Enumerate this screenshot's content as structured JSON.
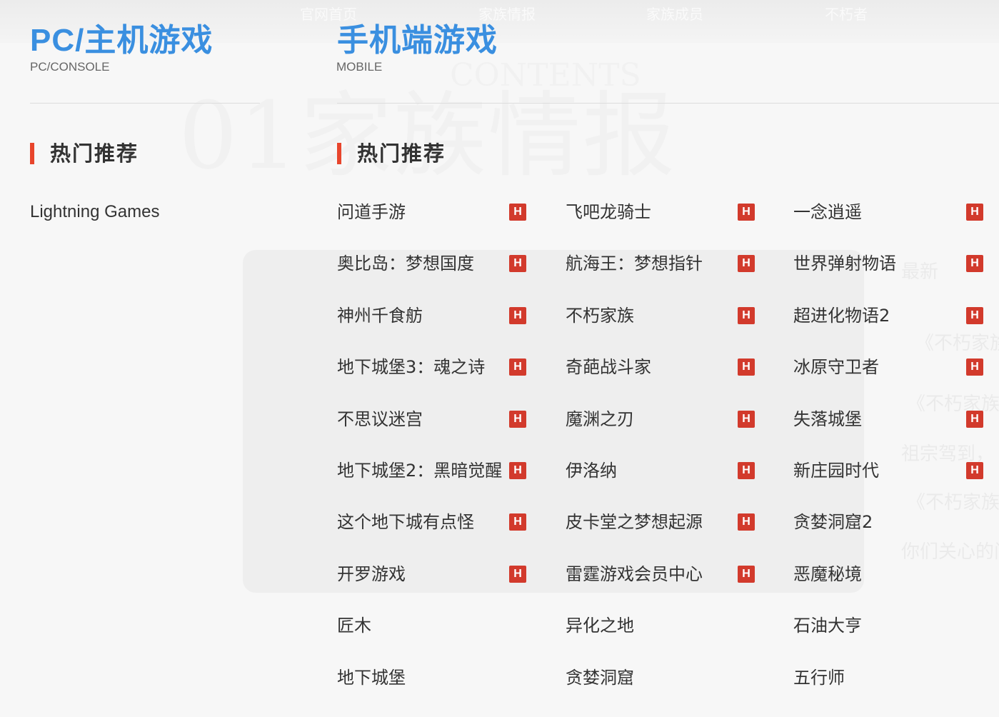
{
  "pc": {
    "title": "PC/主机游戏",
    "subtitle": "PC/CONSOLE",
    "section": "热门推荐",
    "games": [
      {
        "name": "Lightning Games",
        "hot": false
      }
    ]
  },
  "mobile": {
    "title": "手机端游戏",
    "subtitle": "MOBILE",
    "section": "热门推荐",
    "hot_label": "H",
    "columns": [
      [
        {
          "name": "问道手游",
          "hot": true
        },
        {
          "name": "奥比岛：梦想国度",
          "hot": true
        },
        {
          "name": "神州千食舫",
          "hot": true
        },
        {
          "name": "地下城堡3：魂之诗",
          "hot": true
        },
        {
          "name": "不思议迷宫",
          "hot": true
        },
        {
          "name": "地下城堡2：黑暗觉醒",
          "hot": true
        },
        {
          "name": "这个地下城有点怪",
          "hot": true
        },
        {
          "name": "开罗游戏",
          "hot": true
        },
        {
          "name": "匠木",
          "hot": false
        },
        {
          "name": "地下城堡",
          "hot": false
        }
      ],
      [
        {
          "name": "飞吧龙骑士",
          "hot": true
        },
        {
          "name": "航海王：梦想指针",
          "hot": true
        },
        {
          "name": "不朽家族",
          "hot": true
        },
        {
          "name": "奇葩战斗家",
          "hot": true
        },
        {
          "name": "魔渊之刃",
          "hot": true
        },
        {
          "name": "伊洛纳",
          "hot": true
        },
        {
          "name": "皮卡堂之梦想起源",
          "hot": true
        },
        {
          "name": "雷霆游戏会员中心",
          "hot": true
        },
        {
          "name": "异化之地",
          "hot": false
        },
        {
          "name": "贪婪洞窟",
          "hot": false
        }
      ],
      [
        {
          "name": "一念逍遥",
          "hot": true
        },
        {
          "name": "世界弹射物语",
          "hot": true
        },
        {
          "name": "超进化物语2",
          "hot": true
        },
        {
          "name": "冰原守卫者",
          "hot": true
        },
        {
          "name": "失落城堡",
          "hot": true
        },
        {
          "name": "新庄园时代",
          "hot": true
        },
        {
          "name": "贪婪洞窟2",
          "hot": false
        },
        {
          "name": "恶魔秘境",
          "hot": false
        },
        {
          "name": "石油大亨",
          "hot": false
        },
        {
          "name": "五行师",
          "hot": false
        }
      ]
    ]
  },
  "background": {
    "nav": [
      "官网首页",
      "家族情报",
      "家族成员",
      "不朽者"
    ],
    "watermark": "01家族情报",
    "watermark_small": "CONTENTS",
    "side_texts": [
      "最新",
      "《不朽家族",
      "《不朽家族》",
      "祖宗驾到，",
      "《不朽家族》",
      "你们关心的问"
    ]
  },
  "colors": {
    "accent_blue": "#3a8fe0",
    "hot_red": "#d23a2c",
    "section_bar": "#e8452c"
  }
}
